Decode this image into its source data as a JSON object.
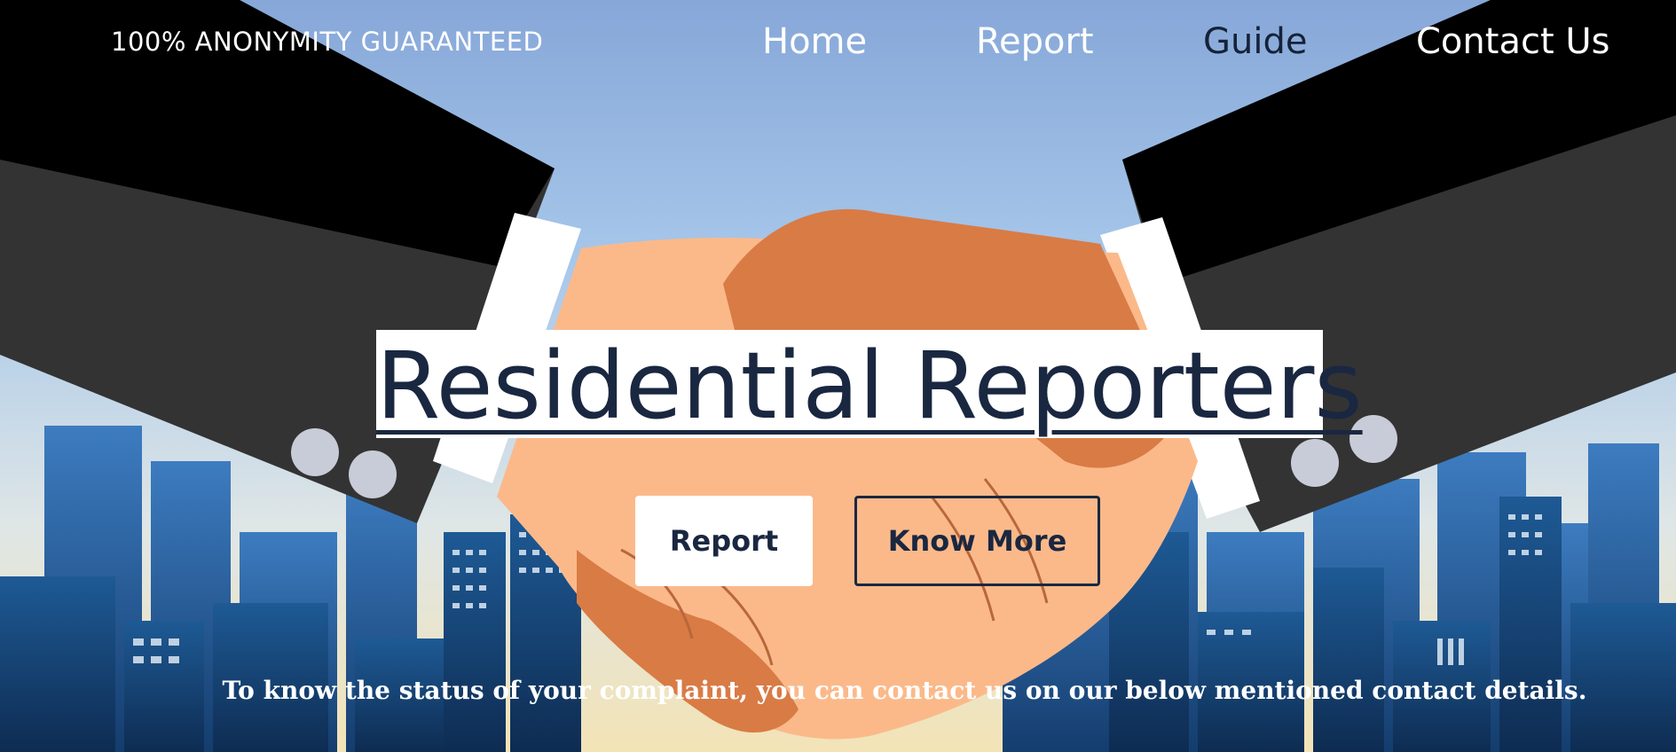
{
  "header": {
    "tagline": "100% ANONYMITY GUARANTEED",
    "nav": [
      {
        "label": "Home",
        "active": false
      },
      {
        "label": "Report",
        "active": false
      },
      {
        "label": "Guide",
        "active": true
      },
      {
        "label": "Contact Us",
        "active": false
      }
    ]
  },
  "hero": {
    "image": "handshake-over-city-skyline",
    "title": "Residential Reporters",
    "buttons": {
      "primary_label": "Report",
      "secondary_label": "Know More"
    },
    "status_note": "To know the status of your complaint, you can contact us on our below mentioned contact details."
  },
  "colors": {
    "navy": "#1a2740",
    "sky": "#8ab0dd",
    "skin_light": "#fbb98a",
    "skin_dark": "#d97b45",
    "suit": "#333333"
  }
}
